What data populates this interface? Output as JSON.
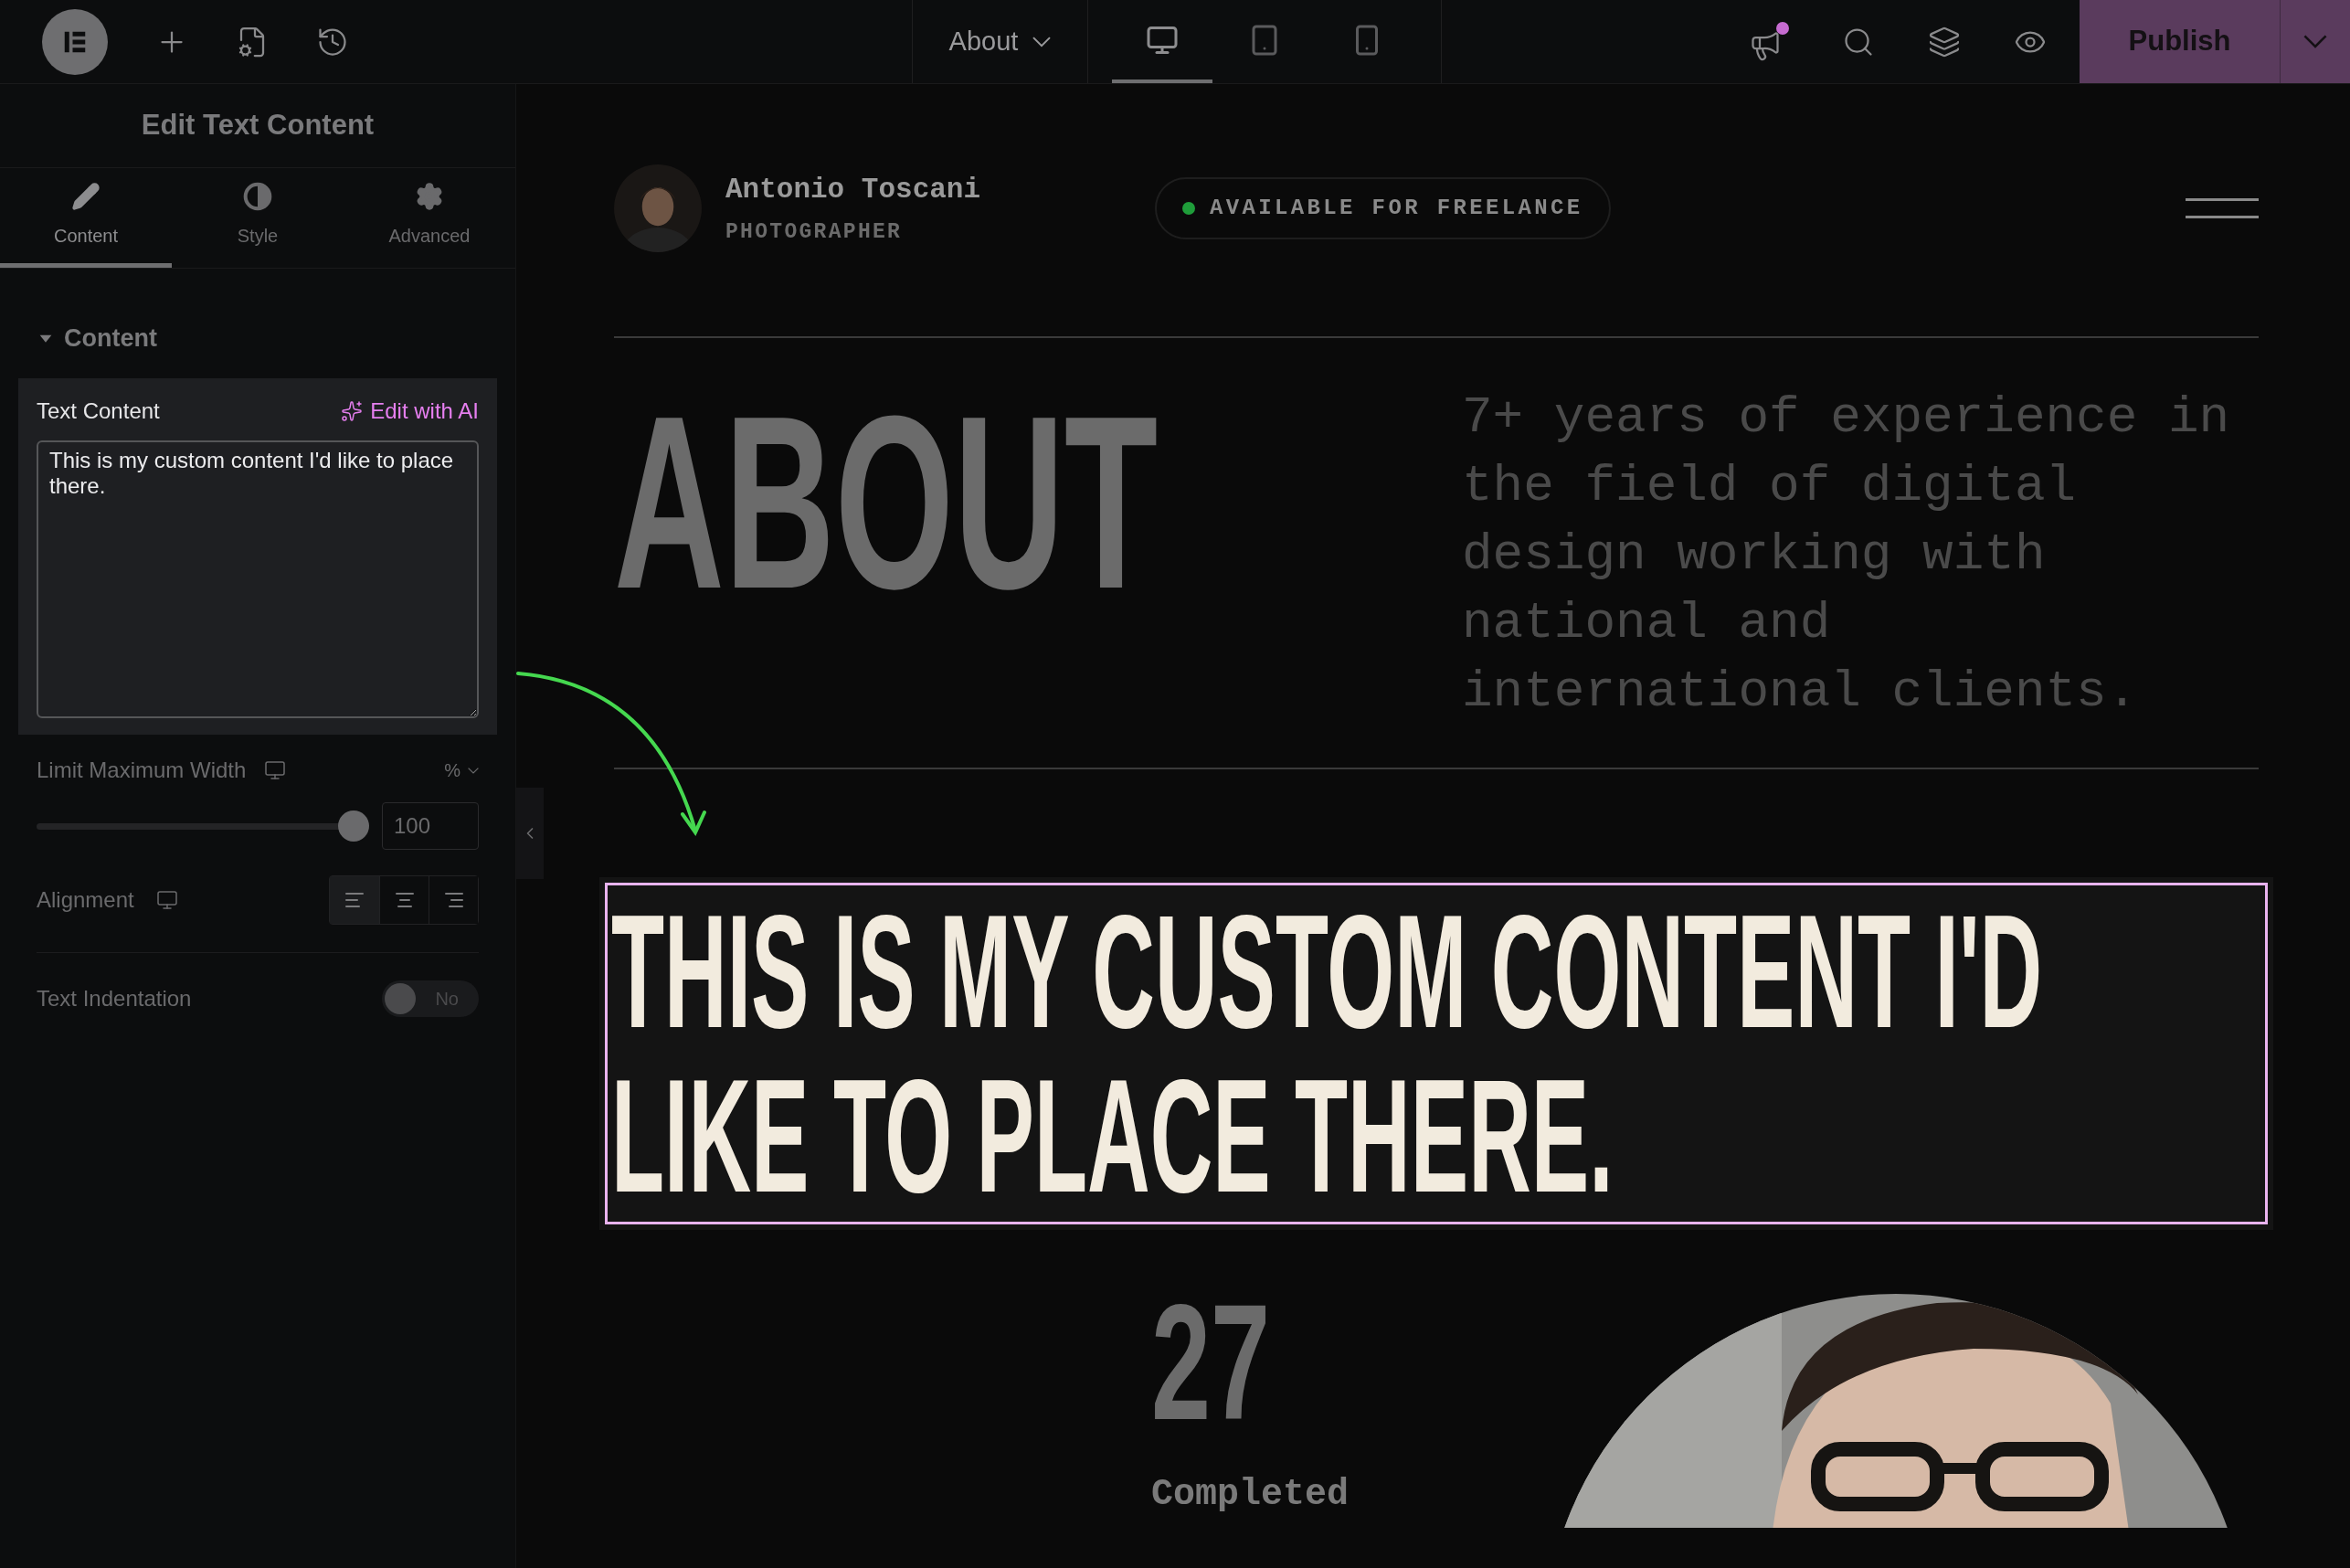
{
  "topbar": {
    "page": "About",
    "devices": [
      {
        "kind": "desktop",
        "selected": true
      },
      {
        "kind": "tablet",
        "selected": false
      },
      {
        "kind": "mobile",
        "selected": false
      }
    ],
    "publish": "Publish"
  },
  "panel": {
    "title": "Edit Text Content",
    "tabs": [
      {
        "kind": "pencil",
        "label": "Content",
        "selected": true
      },
      {
        "kind": "contrast",
        "label": "Style",
        "selected": false
      },
      {
        "kind": "gear",
        "label": "Advanced",
        "selected": false
      }
    ],
    "section": {
      "title": "Content",
      "expanded": true
    },
    "text_content": {
      "label": "Text Content",
      "ai_link": "Edit with AI",
      "value": "This is my custom content I'd like to place there."
    },
    "max_width": {
      "label": "Limit Maximum Width",
      "unit": "%",
      "level": 1,
      "value": "100"
    },
    "alignment": {
      "label": "Alignment",
      "options": [
        {
          "kind": "left",
          "selected": true
        },
        {
          "kind": "center",
          "selected": false
        },
        {
          "kind": "right",
          "selected": false
        }
      ]
    },
    "indentation": {
      "label": "Text Indentation",
      "on": false,
      "state_label": "No"
    }
  },
  "canvas": {
    "name": "Antonio Toscani",
    "role": "PHOTOGRAPHER",
    "badge": {
      "text": "AVAILABLE FOR FREELANCE",
      "color": "#1f9d3a"
    },
    "heading": "ABOUT",
    "description": "7+ years of experience in the field of digital design working with national and international clients.",
    "selected_heading": "THIS IS MY CUSTOM CONTENT I'D LIKE TO PLACE THERE.",
    "stat": {
      "value": "27",
      "label": "Completed"
    }
  }
}
